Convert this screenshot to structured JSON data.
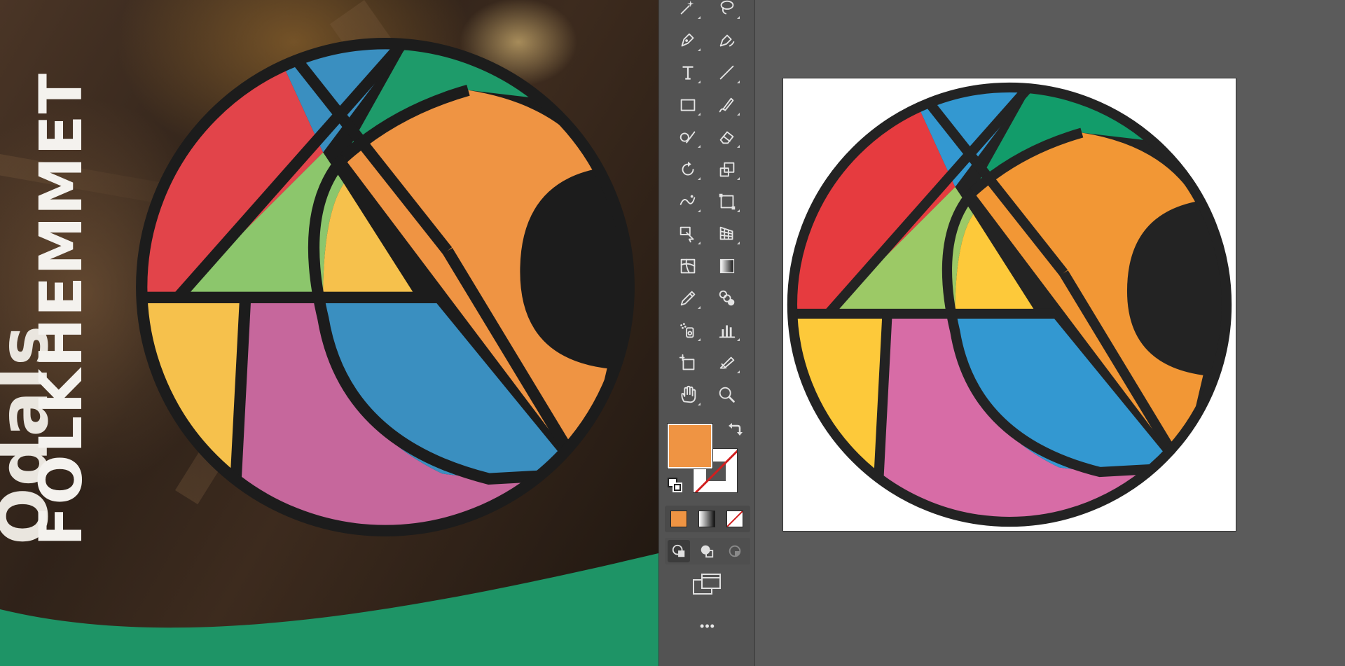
{
  "poster": {
    "title_line1": "Ödals",
    "title_line2": "FOLKHEMMET"
  },
  "toolbar": {
    "tools": [
      {
        "name": "magic-wand-icon",
        "corner": true
      },
      {
        "name": "lasso-icon",
        "corner": true
      },
      {
        "name": "pen-icon",
        "corner": true
      },
      {
        "name": "curvature-icon",
        "corner": false
      },
      {
        "name": "type-icon",
        "corner": true
      },
      {
        "name": "line-segment-icon",
        "corner": true
      },
      {
        "name": "rectangle-icon",
        "corner": true
      },
      {
        "name": "paintbrush-icon",
        "corner": true
      },
      {
        "name": "shaper-icon",
        "corner": true
      },
      {
        "name": "eraser-icon",
        "corner": true
      },
      {
        "name": "rotate-icon",
        "corner": true
      },
      {
        "name": "scale-icon",
        "corner": true
      },
      {
        "name": "warp-icon",
        "corner": true
      },
      {
        "name": "free-transform-icon",
        "corner": true
      },
      {
        "name": "shape-builder-icon",
        "corner": true
      },
      {
        "name": "perspective-grid-icon",
        "corner": true
      },
      {
        "name": "mesh-icon",
        "corner": false
      },
      {
        "name": "gradient-icon",
        "corner": false
      },
      {
        "name": "eyedropper-icon",
        "corner": true
      },
      {
        "name": "blend-icon",
        "corner": false
      },
      {
        "name": "symbol-sprayer-icon",
        "corner": true
      },
      {
        "name": "column-graph-icon",
        "corner": true
      },
      {
        "name": "artboard-icon",
        "corner": false
      },
      {
        "name": "slice-icon",
        "corner": true
      },
      {
        "name": "hand-icon",
        "corner": true
      },
      {
        "name": "zoom-icon",
        "corner": false
      }
    ],
    "fill_color": "#ef9443",
    "stroke_color": "none",
    "more_label": "•••"
  },
  "logo": {
    "segments": {
      "red": "#e2444a",
      "blue": "#3a8fc0",
      "green": "#1e9b6a",
      "orange": "#ef9443",
      "lightgreen": "#8cc66c",
      "yellow": "#f6c14c",
      "pink": "#c6679c",
      "dark": "#1c1c1c"
    }
  },
  "artboard_logo": {
    "segments": {
      "red": "#e63b3f",
      "blue": "#3398d1",
      "green": "#129c6a",
      "orange": "#f29735",
      "lightgreen": "#9cc966",
      "yellow": "#fdc93a",
      "pink": "#d76ca6",
      "dark": "#232323"
    }
  }
}
